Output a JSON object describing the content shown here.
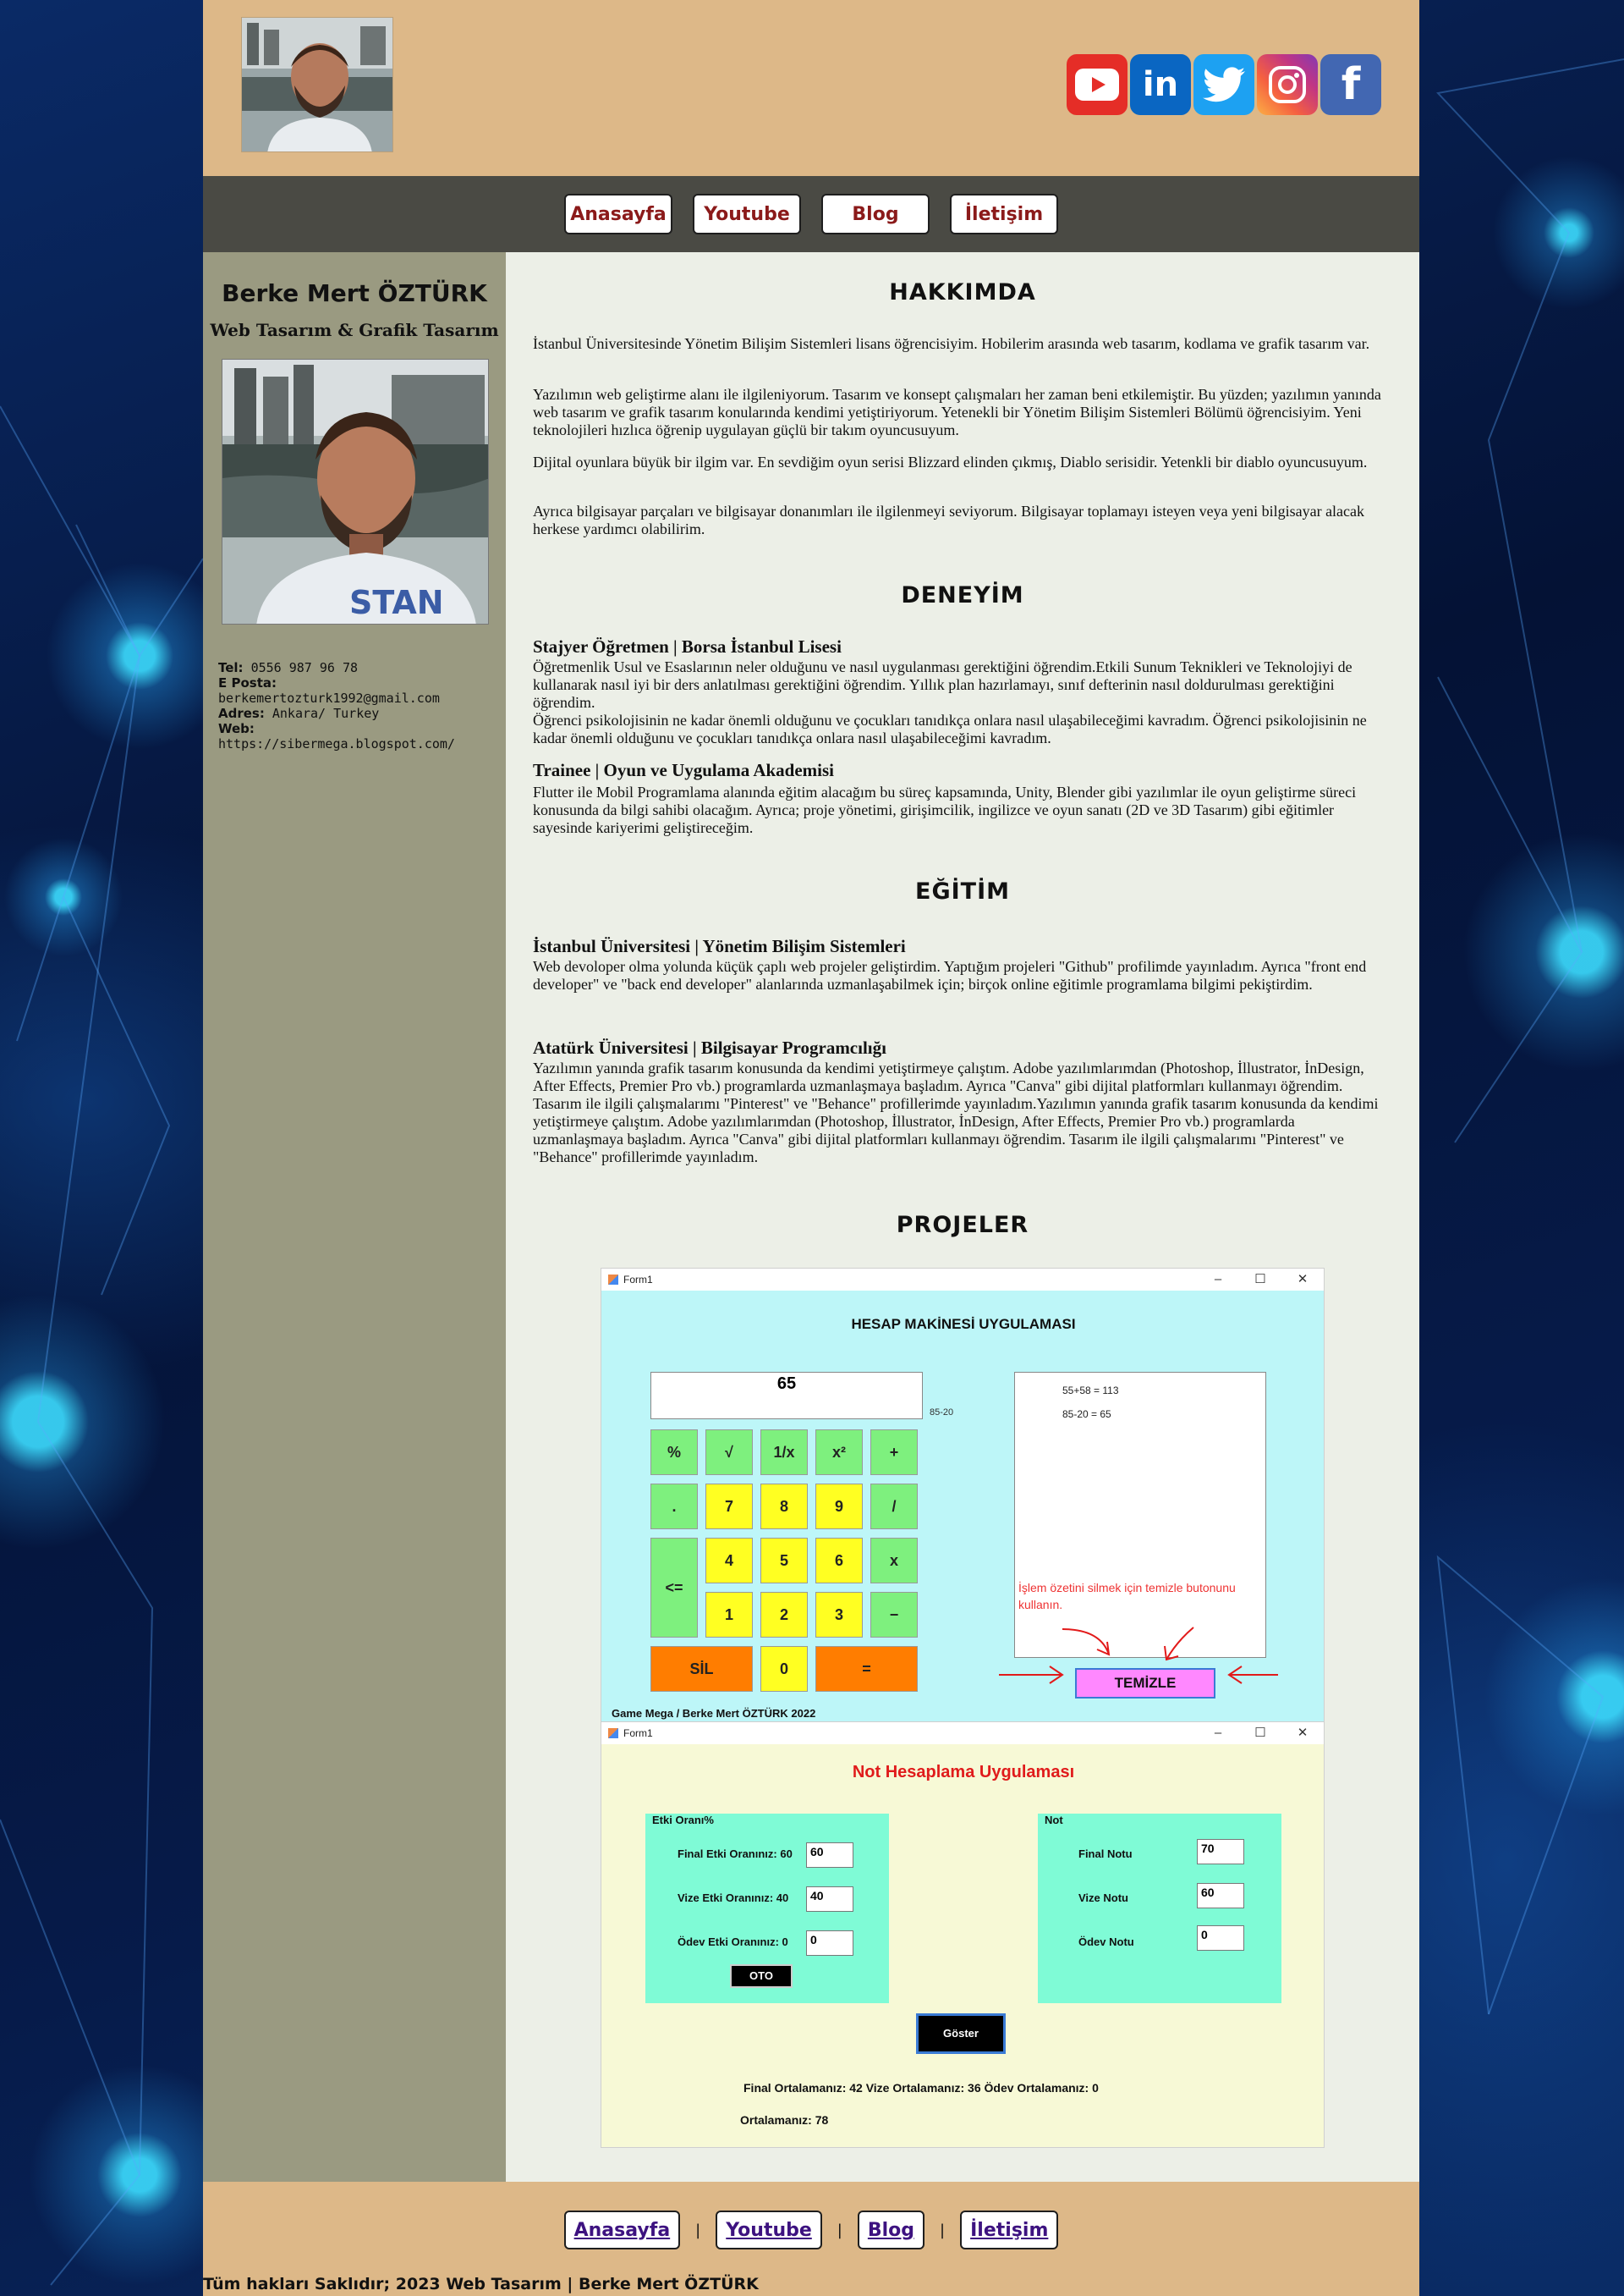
{
  "header": {
    "social": [
      "youtube",
      "linkedin",
      "twitter",
      "instagram",
      "facebook"
    ]
  },
  "nav": [
    "Anasayfa",
    "Youtube",
    "Blog",
    "İletişim"
  ],
  "sidebar": {
    "name": "Berke Mert ÖZTÜRK",
    "title": "Web Tasarım & Grafik Tasarım",
    "tel_label": "Tel:",
    "tel": "0556 987 96 78",
    "email_label": "E Posta:",
    "email": "berkemertozturk1992@gmail.com",
    "address_label": "Adres:",
    "address": "Ankara/ Turkey",
    "web_label": "Web:",
    "web": "https://sibermega.blogspot.com/"
  },
  "about": {
    "heading": "HAKKIMDA",
    "paragraphs": [
      "İstanbul Üniversitesinde Yönetim Bilişim Sistemleri lisans öğrencisiyim. Hobilerim arasında web tasarım, kodlama ve grafik tasarım var.",
      "Yazılımın web geliştirme alanı ile ilgileniyorum. Tasarım ve konsept çalışmaları her zaman beni etkilemiştir. Bu yüzden; yazılımın yanında web tasarım ve grafik tasarım konularında kendimi yetiştiriyorum. Yetenekli bir Yönetim Bilişim Sistemleri Bölümü öğrencisiyim. Yeni teknolojileri hızlıca öğrenip uygulayan güçlü bir takım oyuncusuyum.",
      "Dijital oyunlara büyük bir ilgim var. En sevdiğim oyun serisi Blizzard elinden çıkmış, Diablo serisidir. Yetenkli bir diablo oyuncusuyum.",
      "Ayrıca bilgisayar parçaları ve bilgisayar donanımları ile ilgilenmeyi seviyorum. Bilgisayar toplamayı isteyen veya yeni bilgisayar alacak herkese yardımcı olabilirim."
    ]
  },
  "experience": {
    "heading": "DENEYİM",
    "items": [
      {
        "title": "Stajyer Öğretmen | Borsa İstanbul Lisesi",
        "text": "Öğretmenlik Usul ve Esaslarının neler olduğunu ve nasıl uygulanması gerektiğini öğrendim.Etkili Sunum Teknikleri ve Teknolojiyi de kullanarak nasıl iyi bir ders anlatılması gerektiğini öğrendim. Yıllık plan hazırlamayı, sınıf defterinin nasıl doldurulması gerektiğini öğrendim.",
        "text2": "Öğrenci psikolojisinin ne kadar önemli olduğunu ve çocukları tanıdıkça onlara nasıl ulaşabileceğimi kavradım. Öğrenci psikolojisinin ne kadar önemli olduğunu ve çocukları tanıdıkça onlara nasıl ulaşabileceğimi kavradım."
      },
      {
        "title": "Trainee | Oyun ve Uygulama Akademisi",
        "text": "Flutter ile Mobil Programlama alanında eğitim alacağım bu süreç kapsamında, Unity, Blender gibi yazılımlar ile oyun geliştirme süreci konusunda da bilgi sahibi olacağım. Ayrıca; proje yönetimi, girişimcilik, ingilizce ve oyun sanatı (2D ve 3D Tasarım) gibi eğitimler sayesinde kariyerimi geliştireceğim."
      }
    ]
  },
  "education": {
    "heading": "EĞİTİM",
    "items": [
      {
        "title": "İstanbul Üniversitesi | Yönetim Bilişim Sistemleri",
        "text": "Web devoloper olma yolunda küçük çaplı web projeler geliştirdim. Yaptığım projeleri \"Github\" profilimde yayınladım. Ayrıca \"front end developer\" ve \"back end developer\" alanlarında uzmanlaşabilmek için; birçok online eğitimle programlama bilgimi pekiştirdim."
      },
      {
        "title": "Atatürk Üniversitesi | Bilgisayar Programcılığı",
        "text": "Yazılımın yanında grafik tasarım konusunda da kendimi yetiştirmeye çalıştım. Adobe yazılımlarımdan (Photoshop, İllustrator, İnDesign, After Effects, Premier Pro vb.) programlarda uzmanlaşmaya başladım. Ayrıca \"Canva\" gibi dijital platformları kullanmayı öğrendim. Tasarım ile ilgili çalışmalarımı \"Pinterest\" ve \"Behance\" profillerimde yayınladım.Yazılımın yanında grafik tasarım konusunda da kendimi yetiştirmeye çalıştım. Adobe yazılımlarımdan (Photoshop, İllustrator, İnDesign, After Effects, Premier Pro vb.) programlarda uzmanlaşmaya başladım. Ayrıca \"Canva\" gibi dijital platformları kullanmayı öğrendim. Tasarım ile ilgili çalışmalarımı \"Pinterest\" ve \"Behance\" profillerimde yayınladım."
      }
    ]
  },
  "projects": {
    "heading": "PROJELER",
    "calculator": {
      "window_title": "Form1",
      "title": "HESAP MAKİNESİ UYGULAMASI",
      "display": "65",
      "hint": "85-20",
      "keys": [
        "%",
        "√",
        "1/x",
        "x²",
        "+",
        ".",
        "7",
        "8",
        "9",
        "/",
        "<=",
        "4",
        "5",
        "6",
        "x",
        "1",
        "2",
        "3",
        "−",
        "SİL",
        "0",
        "="
      ],
      "log": [
        "55+58 = 113",
        "85-20 = 65"
      ],
      "warning": "İşlem özetini silmek için temizle butonunu kullanın.",
      "clear_button": "TEMİZLE",
      "footer": "Game Mega / Berke Mert ÖZTÜRK 2022"
    },
    "grades": {
      "window_title": "Form1",
      "title": "Not Hesaplama Uygulaması",
      "rates_group": "Etki Oranı%",
      "rates": [
        {
          "label": "Final Etki Oranınız: 60",
          "value": "60"
        },
        {
          "label": "Vize Etki Oranınız: 40",
          "value": "40"
        },
        {
          "label": "Ödev Etki Oranınız: 0",
          "value": "0"
        }
      ],
      "oto_button": "OTO",
      "grades_group": "Not",
      "grades": [
        {
          "label": "Final Notu",
          "value": "70"
        },
        {
          "label": "Vize Notu",
          "value": "60"
        },
        {
          "label": "Ödev Notu",
          "value": "0"
        }
      ],
      "show_button": "Göster",
      "result_line": "Final Ortalamanız: 42 Vize Ortalamanız: 36 Ödev Ortalamanız: 0",
      "average": "Ortalamanız: 78"
    }
  },
  "footer": {
    "links": [
      "Anasayfa",
      "Youtube",
      "Blog",
      "İletişim"
    ],
    "separator": "|",
    "copyright": "Tüm hakları Saklıdır; 2023 Web Tasarım | Berke Mert ÖZTÜRK"
  },
  "colors": {
    "header_bg": "#ddb888",
    "nav_bg": "#4a4a44",
    "sidebar_bg": "#9a9a81",
    "main_bg": "#ecefe7",
    "nav_text": "#8b1a1a"
  }
}
